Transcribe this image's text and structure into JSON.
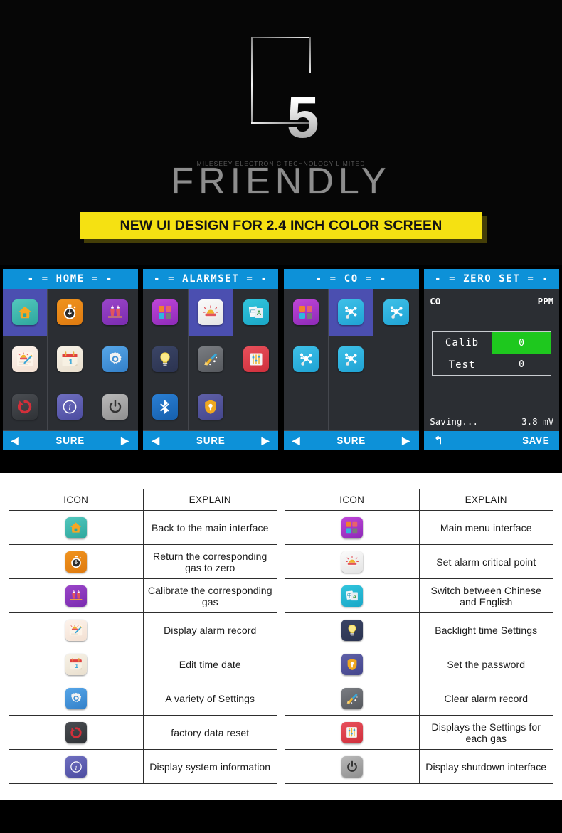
{
  "hero": {
    "logo_number": "5",
    "company": "MILESEEY ELECTRONIC TECHNOLOGY LIMITED",
    "headline": "FRIENDLY",
    "banner": "NEW UI DESIGN FOR 2.4 INCH COLOR SCREEN",
    "banner_color": "#f5e112",
    "background": "#060606"
  },
  "screens": {
    "accent_blue": "#0d91d8",
    "selection_color": "#4b4fb0",
    "panel_bg": "#2b2e33",
    "items": [
      {
        "title": "- = HOME = -",
        "footer": {
          "prev": "◀",
          "label": "SURE",
          "next": "▶"
        },
        "icons": [
          {
            "name": "home-icon",
            "selected": true
          },
          {
            "name": "zero-timer-icon",
            "selected": false
          },
          {
            "name": "calibrate-icon",
            "selected": false
          },
          {
            "name": "alarm-record-icon",
            "selected": false
          },
          {
            "name": "calendar-icon",
            "selected": false
          },
          {
            "name": "settings-gear-icon",
            "selected": false
          },
          {
            "name": "factory-reset-icon",
            "selected": false
          },
          {
            "name": "info-icon",
            "selected": false
          },
          {
            "name": "power-icon",
            "selected": false
          }
        ]
      },
      {
        "title": "- = ALARMSET = -",
        "footer": {
          "prev": "◀",
          "label": "SURE",
          "next": "▶"
        },
        "icons": [
          {
            "name": "main-menu-icon",
            "selected": false
          },
          {
            "name": "alarm-set-icon",
            "selected": true
          },
          {
            "name": "language-icon",
            "selected": false
          },
          {
            "name": "backlight-icon",
            "selected": false
          },
          {
            "name": "clear-record-icon",
            "selected": false
          },
          {
            "name": "gas-settings-icon",
            "selected": false
          },
          {
            "name": "bluetooth-icon",
            "selected": false
          },
          {
            "name": "password-icon",
            "selected": false
          },
          {
            "name": "empty",
            "selected": false
          }
        ]
      },
      {
        "title": "- = CO = -",
        "footer": {
          "prev": "◀",
          "label": "SURE",
          "next": "▶"
        },
        "icons": [
          {
            "name": "main-menu-icon",
            "selected": false
          },
          {
            "name": "molecule-icon",
            "selected": true
          },
          {
            "name": "molecule-icon",
            "selected": false
          },
          {
            "name": "molecule-icon",
            "selected": false
          },
          {
            "name": "molecule-icon",
            "selected": false
          },
          {
            "name": "empty",
            "selected": false
          },
          {
            "name": "empty",
            "selected": false
          },
          {
            "name": "empty",
            "selected": false
          },
          {
            "name": "empty",
            "selected": false
          }
        ]
      }
    ],
    "zero_set": {
      "title": "- = ZERO SET = -",
      "gas_label": "CO",
      "unit_label": "PPM",
      "rows": [
        {
          "label": "Calib",
          "value": "0",
          "highlighted": true
        },
        {
          "label": "Test",
          "value": "0",
          "highlighted": false
        }
      ],
      "status": "Saving...",
      "voltage": "3.8 mV",
      "footer": {
        "back": "↰",
        "save": "SAVE"
      },
      "highlight_color": "#1ec81e"
    }
  },
  "tables": {
    "headers": {
      "icon": "ICON",
      "explain": "EXPLAIN"
    },
    "left_rows": [
      {
        "icon": "home-icon",
        "explain": "Back to the main interface"
      },
      {
        "icon": "zero-timer-icon",
        "explain": "Return the corresponding gas to zero"
      },
      {
        "icon": "calibrate-icon",
        "explain": "Calibrate the corresponding gas"
      },
      {
        "icon": "alarm-record-icon",
        "explain": "Display alarm record"
      },
      {
        "icon": "calendar-icon",
        "explain": "Edit time date"
      },
      {
        "icon": "settings-gear-icon",
        "explain": "A variety of Settings"
      },
      {
        "icon": "factory-reset-icon",
        "explain": "factory data reset"
      },
      {
        "icon": "info-icon",
        "explain": "Display system information"
      }
    ],
    "right_rows": [
      {
        "icon": "main-menu-icon",
        "explain": "Main menu interface"
      },
      {
        "icon": "alarm-set-icon",
        "explain": "Set alarm critical point"
      },
      {
        "icon": "language-icon",
        "explain": "Switch between Chinese and English"
      },
      {
        "icon": "backlight-icon",
        "explain": "Backlight time Settings"
      },
      {
        "icon": "password-icon",
        "explain": "Set the password"
      },
      {
        "icon": "clear-record-icon",
        "explain": "Clear alarm record"
      },
      {
        "icon": "gas-settings-icon",
        "explain": "Displays the Settings for each gas"
      },
      {
        "icon": "power-icon",
        "explain": "Display shutdown interface"
      }
    ]
  }
}
